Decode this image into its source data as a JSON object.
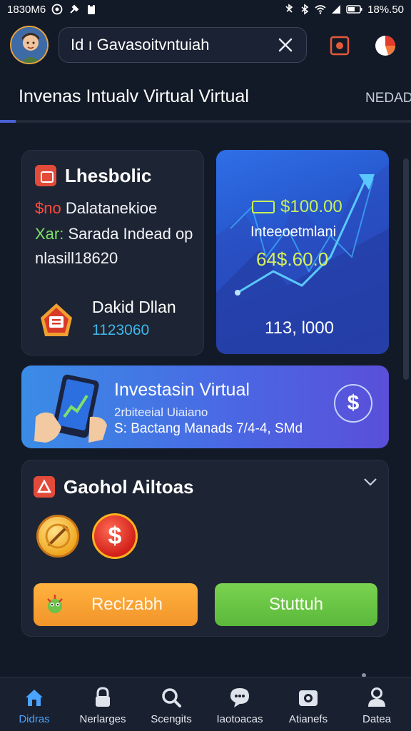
{
  "status_bar": {
    "time": "1830M6",
    "battery": "18%.50",
    "icons": [
      "whatsapp-icon",
      "tool-icon",
      "clipboard-icon",
      "bluetooth-off-icon",
      "bluetooth-icon",
      "wifi-icon",
      "signal-icon",
      "battery-icon"
    ]
  },
  "header": {
    "search_value": "Id ı Gavasoitvntuiah",
    "clear_icon": "close-icon",
    "record_icon": "record-icon",
    "profile_icon": "pie-badge-icon"
  },
  "tabs": {
    "active_label": "Invenas Intualv Virtual Virtual",
    "side_label": "NEDAD"
  },
  "card_left": {
    "title": "Lhesbolic",
    "line1_prefix": "$no",
    "line1_text": "Dalatanekioe",
    "line2_prefix": "Xar:",
    "line2_text": "Sarada Indead op",
    "line3_text": "nlasill18620",
    "name": "Dakid Dllan",
    "number": "1123060"
  },
  "card_chart": {
    "price": "$100.00",
    "label": "Inteeoetmlani",
    "value": "64$.60.0",
    "footer": "113, l000"
  },
  "banner": {
    "title": "Investasin Virtual",
    "subtitle": "2rbiteeial Uiaiano",
    "detail": "S: Bactang Manads 7/4-4, SMd",
    "dollar_symbol": "$"
  },
  "actions_card": {
    "title": "Gaohol Ailtoas",
    "coin_symbol": "$",
    "button_left": "Reclzabh",
    "button_right": "Stuttuh"
  },
  "bottom_nav": [
    {
      "label": "Didras",
      "icon": "home-icon"
    },
    {
      "label": "Nerlarges",
      "icon": "lock-icon"
    },
    {
      "label": "Scengits",
      "icon": "search-icon"
    },
    {
      "label": "Iaotoacas",
      "icon": "chat-bubble-icon"
    },
    {
      "label": "Atianefs",
      "icon": "camera-icon"
    },
    {
      "label": "Datea",
      "icon": "user-icon"
    }
  ],
  "colors": {
    "background": "#131a27",
    "accent_blue": "#4a61d6",
    "accent_orange": "#f2942a",
    "accent_green": "#5bb83b",
    "price_green": "#c9f05a"
  }
}
